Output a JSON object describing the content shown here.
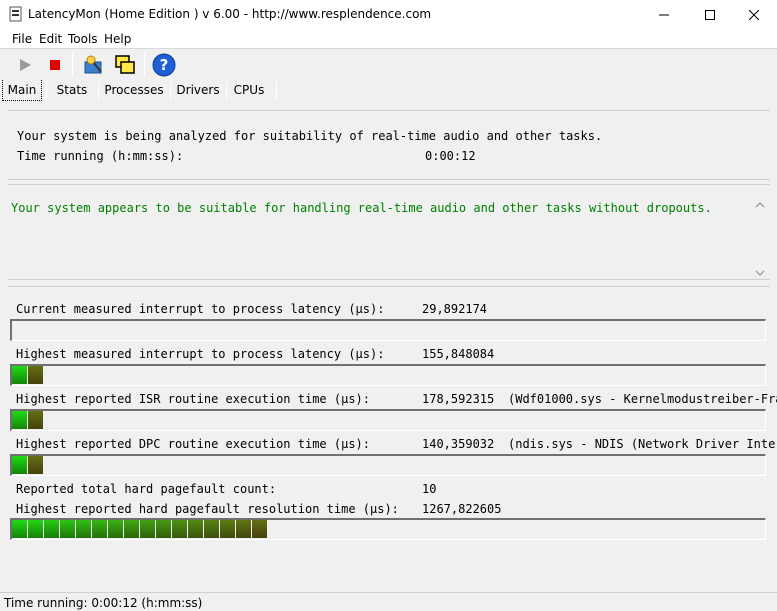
{
  "window": {
    "title": "LatencyMon  (Home Edition )  v 6.00 - http://www.resplendence.com",
    "minimize_icon": "minimize-icon",
    "maximize_icon": "maximize-icon",
    "close_icon": "close-icon"
  },
  "menu": [
    "File",
    "Edit",
    "Tools",
    "Help"
  ],
  "toolbar": {
    "buttons": [
      "play-icon",
      "stop-icon",
      "drivers-icon",
      "windows-icon",
      "help-icon"
    ]
  },
  "tabs": [
    "Main",
    "Stats",
    "Processes",
    "Drivers",
    "CPUs"
  ],
  "analysis": {
    "line1": "Your system is being analyzed for suitability of real-time audio and other tasks.",
    "time_label": "Time running (h:mm:ss):",
    "time_value": "0:00:12"
  },
  "verdict": {
    "text": "Your system appears to be suitable for handling real-time audio and other tasks without dropouts.",
    "color": "#008000"
  },
  "metrics": [
    {
      "label": "Current measured interrupt to process latency (µs):",
      "value": "29,892174",
      "detail": "",
      "bar_level": 0.0
    },
    {
      "label": "Highest measured interrupt to process latency (µs):",
      "value": "155,848084",
      "detail": "",
      "bar_level": 0.04
    },
    {
      "label": "Highest reported ISR routine execution time (µs):",
      "value": "178,592315",
      "detail": "(Wdf01000.sys - Kernelmodustreiber-Fra",
      "bar_level": 0.04
    },
    {
      "label": "Highest reported DPC routine execution time (µs):",
      "value": "140,359032",
      "detail": "(ndis.sys - NDIS (Network Driver Inter",
      "bar_level": 0.04
    },
    {
      "label": "Reported total hard pagefault count:",
      "value": "10",
      "detail": "",
      "bar_level": null
    },
    {
      "label": "Highest reported hard pagefault resolution time (µs):",
      "value": "1267,822605",
      "detail": "",
      "bar_level": 0.33
    }
  ],
  "status": {
    "text": "Time running: 0:00:12  (h:mm:ss)"
  },
  "colors": {
    "bar_green": "#11aa11",
    "bar_olive": "#667700"
  }
}
